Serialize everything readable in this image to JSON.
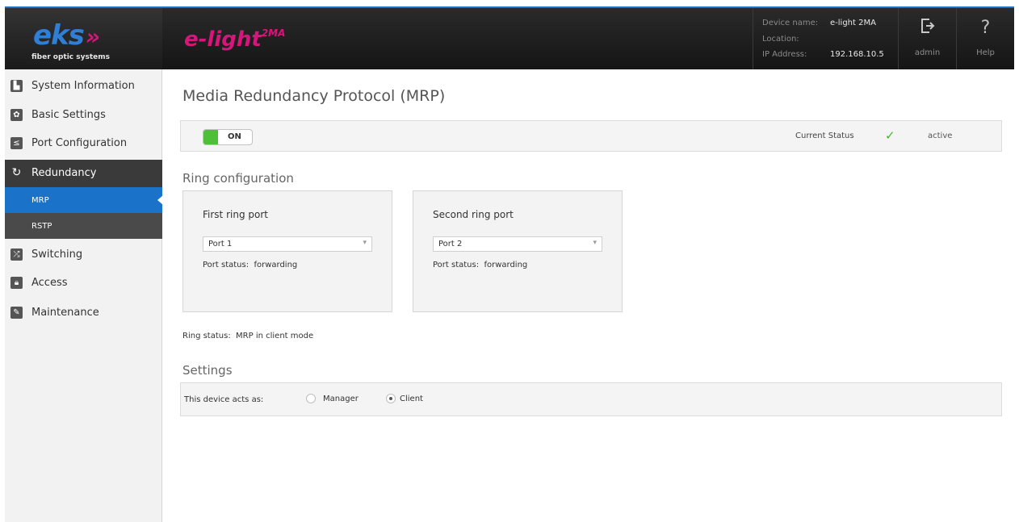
{
  "header": {
    "logo_text": "eks",
    "logo_arrows": "»",
    "logo_subtitle": "fiber optic systems",
    "product_name": "e-light",
    "product_suffix": "2MA",
    "device_name_label": "Device name:",
    "device_name_value": "e-light 2MA",
    "location_label": "Location:",
    "location_value": "",
    "ip_label": "IP Address:",
    "ip_value": "192.168.10.5",
    "user_button": {
      "label": "admin",
      "icon": "logout-icon"
    },
    "help_button": {
      "label": "Help",
      "icon": "help-icon"
    }
  },
  "sidebar": {
    "items": [
      {
        "label": "System Information",
        "icon": "chart-icon"
      },
      {
        "label": "Basic Settings",
        "icon": "gear-icon"
      },
      {
        "label": "Port Configuration",
        "icon": "port-icon"
      },
      {
        "label": "Redundancy",
        "icon": "cycle-icon"
      },
      {
        "label": "Switching",
        "icon": "shuffle-icon"
      },
      {
        "label": "Access",
        "icon": "lock-icon"
      },
      {
        "label": "Maintenance",
        "icon": "wrench-icon"
      }
    ],
    "subitems": [
      {
        "label": "MRP",
        "active": true
      },
      {
        "label": "RSTP",
        "active": false
      }
    ]
  },
  "main": {
    "title": "Media Redundancy Protocol (MRP)",
    "toggle_label": "ON",
    "current_status_label": "Current Status",
    "current_status_value": "active",
    "ring_config_title": "Ring configuration",
    "first_port": {
      "title": "First ring port",
      "selected": "Port 1",
      "status_label": "Port status:",
      "status_value": "forwarding"
    },
    "second_port": {
      "title": "Second ring port",
      "selected": "Port 2",
      "status_label": "Port status:",
      "status_value": "forwarding"
    },
    "ring_status_label": "Ring status:",
    "ring_status_value": "MRP in client mode",
    "settings_title": "Settings",
    "acts_as_label": "This device acts as:",
    "role_options": [
      "Manager",
      "Client"
    ],
    "role_selected": "Client"
  },
  "colors": {
    "accent": "#1a73c8",
    "brand_magenta": "#d8157a",
    "toggle_on": "#4fbf3a",
    "status_ok": "#45b526"
  }
}
